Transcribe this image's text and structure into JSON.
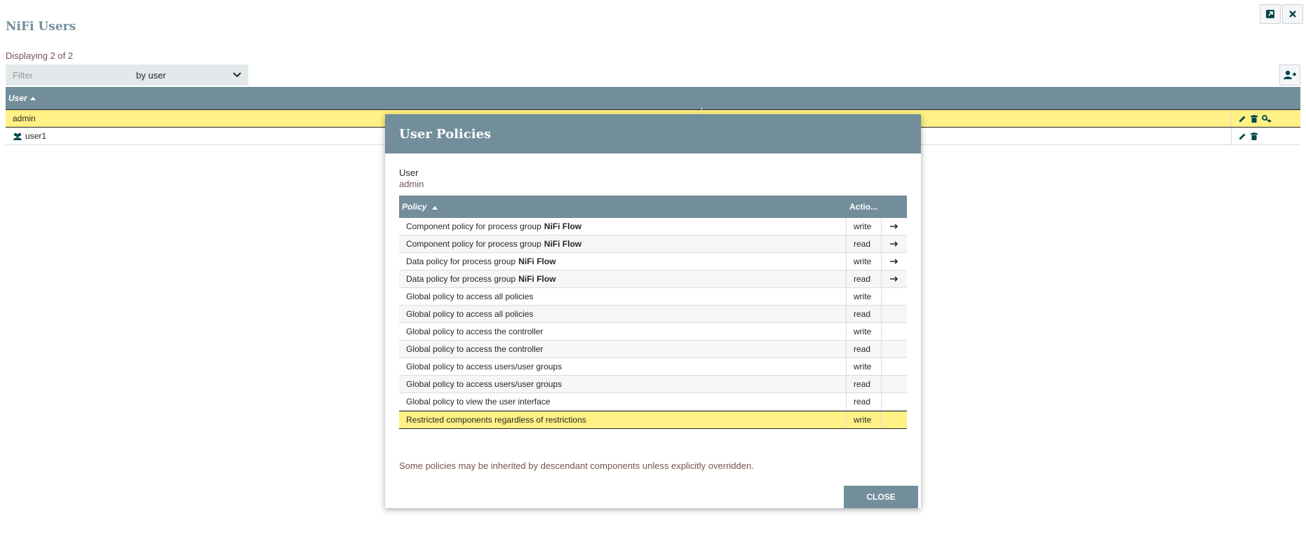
{
  "page": {
    "title": "NiFi Users",
    "displaying": "Displaying 2 of 2"
  },
  "filter": {
    "placeholder": "Filter",
    "value": "",
    "by": "by user"
  },
  "users_table": {
    "header": "User",
    "rows": [
      {
        "name": "admin",
        "icon": "",
        "actions": [
          "edit-icon",
          "delete-icon",
          "policies-icon"
        ]
      },
      {
        "name": "user1",
        "icon": "users-icon",
        "actions": [
          "edit-icon",
          "delete-icon"
        ]
      }
    ]
  },
  "dialog": {
    "title": "User Policies",
    "user_label": "User",
    "user_value": "admin",
    "columns": {
      "policy": "Policy",
      "action": "Actio..."
    },
    "policies": [
      {
        "text": "Component policy for process group",
        "strong": "NiFi Flow",
        "action": "write",
        "go": true
      },
      {
        "text": "Component policy for process group",
        "strong": "NiFi Flow",
        "action": "read",
        "go": true
      },
      {
        "text": "Data policy for process group",
        "strong": "NiFi Flow",
        "action": "write",
        "go": true
      },
      {
        "text": "Data policy for process group",
        "strong": "NiFi Flow",
        "action": "read",
        "go": true
      },
      {
        "text": "Global policy to access all policies",
        "strong": "",
        "action": "write",
        "go": false
      },
      {
        "text": "Global policy to access all policies",
        "strong": "",
        "action": "read",
        "go": false
      },
      {
        "text": "Global policy to access the controller",
        "strong": "",
        "action": "write",
        "go": false
      },
      {
        "text": "Global policy to access the controller",
        "strong": "",
        "action": "read",
        "go": false
      },
      {
        "text": "Global policy to access users/user groups",
        "strong": "",
        "action": "write",
        "go": false
      },
      {
        "text": "Global policy to access users/user groups",
        "strong": "",
        "action": "read",
        "go": false
      },
      {
        "text": "Global policy to view the user interface",
        "strong": "",
        "action": "read",
        "go": false
      },
      {
        "text": "Restricted components regardless of restrictions",
        "strong": "",
        "action": "write",
        "go": false
      }
    ],
    "note": "Some policies may be inherited by descendant components unless explicitly overridden.",
    "close_label": "CLOSE"
  },
  "colors": {
    "accent": "#728e9b",
    "selected": "#fff185",
    "link": "#775351",
    "icon": "#004849"
  }
}
